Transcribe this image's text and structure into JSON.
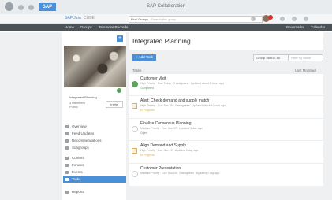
{
  "window": {
    "title": "SAP Collaboration"
  },
  "subbar": {
    "app_name": "SAP Jam",
    "app_name2": "CUBE",
    "search_category": "Find Groups",
    "search_placeholder": "Search this group"
  },
  "nav": {
    "items": [
      "Home",
      "Groups",
      "Business Records",
      "Bookmarks",
      "Calendar"
    ]
  },
  "group": {
    "name": "Integrated Planning",
    "members": "3 members",
    "visibility": "Public",
    "invite_label": "Invite",
    "add_label": "+"
  },
  "menu": {
    "items": [
      {
        "label": "Overview",
        "active": false
      },
      {
        "label": "Feed Updates",
        "active": false
      },
      {
        "label": "Recommendations",
        "active": false
      },
      {
        "label": "Subgroups",
        "active": false
      },
      {
        "label": "Content",
        "active": false
      },
      {
        "label": "Forums",
        "active": false
      },
      {
        "label": "Events",
        "active": false
      },
      {
        "label": "Tasks",
        "active": true
      },
      {
        "label": "Reports",
        "active": false
      }
    ]
  },
  "main": {
    "title": "Integrated Planning",
    "add_task_label": "+ Add Task",
    "status_filter": "Group Status: All",
    "filter_placeholder": "Filter by name",
    "tasks_heading": "Tasks",
    "sort_label": "Last Modified"
  },
  "tasks": [
    {
      "title": "Customer Visit",
      "meta": "High Priority · Due Today · 3 assignees · Updated about 5 hours ago",
      "status": "Completed",
      "state": "done",
      "status_color": "#5aa55a"
    },
    {
      "title": "Alert: Check demand and supply match",
      "meta": "High Priority · Due Nov 25 · 2 assignees · Updated about 5 hours ago",
      "status": "In Progress",
      "state": "prog",
      "status_color": "#e7b04f"
    },
    {
      "title": "Finalize Consensus Planning",
      "meta": "Medium Priority · Due Nov 17 · Updated 1 day ago",
      "status": "Open",
      "state": "open",
      "status_color": "#777777"
    },
    {
      "title": "Align Demand and Supply",
      "meta": "High Priority · Due Nov 20 · Updated 1 day ago",
      "status": "In Progress",
      "state": "prog",
      "status_color": "#e7b04f"
    },
    {
      "title": "Customer Presentation",
      "meta": "Medium Priority · Due Nov 25 · 2 assignees · Updated 1 day ago",
      "status": "",
      "state": "open",
      "status_color": "#777777"
    }
  ],
  "colors": {
    "accent": "#4a90d9",
    "nav_bg": "#4a5258"
  }
}
